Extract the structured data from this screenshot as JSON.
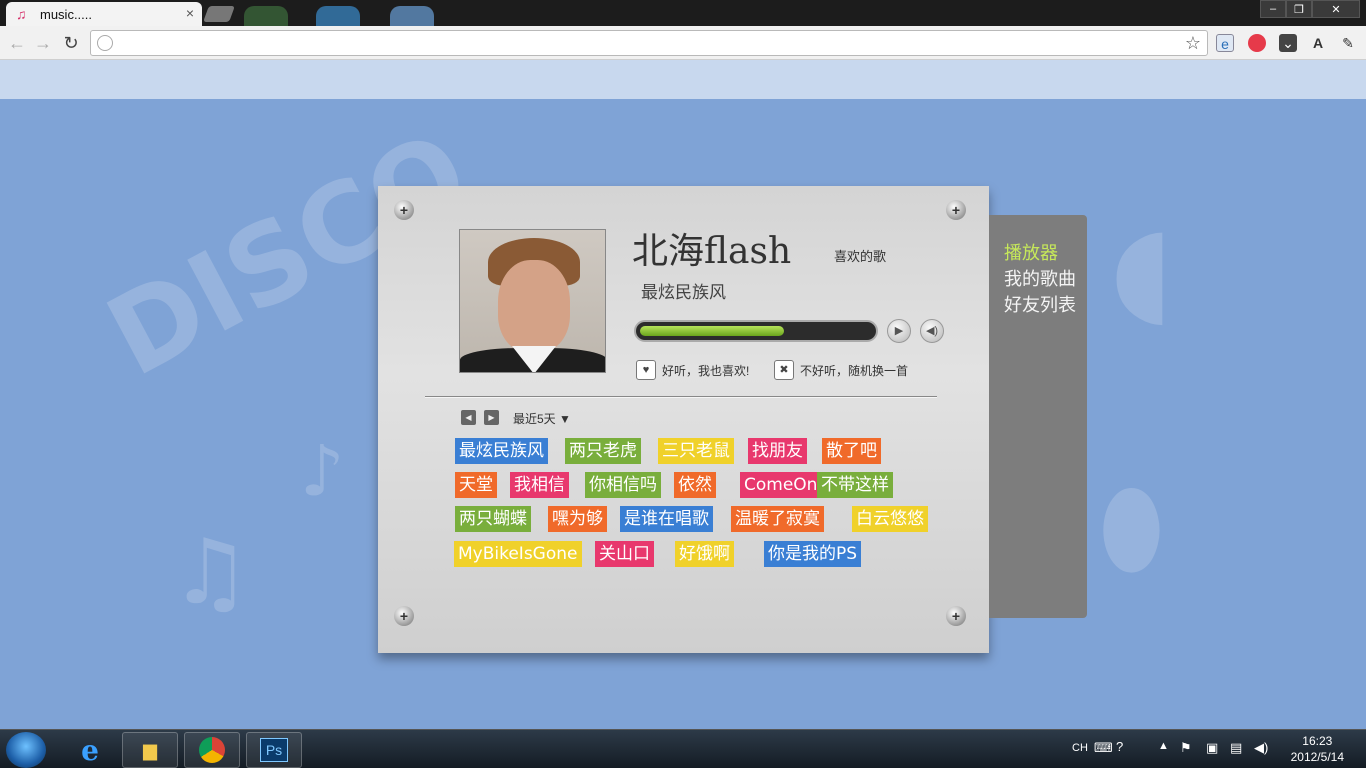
{
  "browser": {
    "tab_title": "music.....",
    "tab_close": "×",
    "tab_icon": "music-note-icon",
    "window_buttons": {
      "minimize": "–",
      "restore": "❐",
      "close": "✕"
    },
    "nav": {
      "back": "←",
      "forward": "→",
      "reload": "↻"
    },
    "address": "",
    "star": "☆"
  },
  "player": {
    "artist": "北海flash",
    "favorite_label": "喜欢的歌",
    "song": "最炫民族风",
    "progress": 0.62,
    "like_text": "好听，我也喜欢!",
    "dislike_text": "不好听，随机换一首",
    "range_label": "最近5天 ▼"
  },
  "tags": [
    {
      "text": "最炫民族风",
      "color": "#3a7fd4"
    },
    {
      "text": "两只老虎",
      "color": "#79ae3c"
    },
    {
      "text": "三只老鼠",
      "color": "#f0d12a"
    },
    {
      "text": "找朋友",
      "color": "#e8386d"
    },
    {
      "text": "散了吧",
      "color": "#f06a2a"
    },
    {
      "text": "天堂",
      "color": "#f06a2a"
    },
    {
      "text": "我相信",
      "color": "#e8386d"
    },
    {
      "text": "你相信吗",
      "color": "#79ae3c"
    },
    {
      "text": "依然",
      "color": "#f06a2a"
    },
    {
      "text": "ComeOn",
      "color": "#e8386d"
    },
    {
      "text": "不带这样",
      "color": "#79ae3c"
    },
    {
      "text": "两只蝴蝶",
      "color": "#79ae3c"
    },
    {
      "text": "嘿为够",
      "color": "#f06a2a"
    },
    {
      "text": "是谁在唱歌",
      "color": "#3a7fd4"
    },
    {
      "text": "温暖了寂寞",
      "color": "#f06a2a"
    },
    {
      "text": "白云悠悠",
      "color": "#f0d12a"
    },
    {
      "text": "MyBikeIsGone",
      "color": "#f0d12a"
    },
    {
      "text": "关山口",
      "color": "#e8386d"
    },
    {
      "text": "好饿啊",
      "color": "#f0d12a"
    },
    {
      "text": "你是我的PS",
      "color": "#3a7fd4"
    }
  ],
  "side_menu": [
    "播放器",
    "我的歌曲",
    "好友列表"
  ],
  "taskbar": {
    "ps_label": "Ps",
    "lang": "CH",
    "time": "16:23",
    "date": "2012/5/14"
  },
  "colors": {
    "page_bg": "#7fa3d6",
    "accent_green": "#c6e85a"
  }
}
